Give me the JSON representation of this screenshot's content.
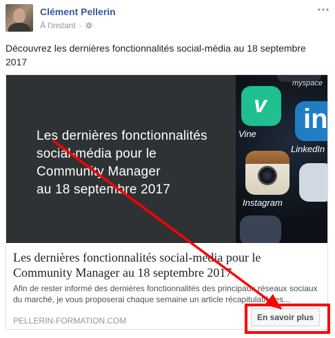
{
  "post": {
    "author": "Clément Pellerin",
    "timestamp": "À l'instant",
    "separator": "·",
    "privacy_icon": "gear-icon",
    "menu_icon": "more-icon",
    "text": "Découvrez les dernières fonctionnalités social-média au 18 septembre 2017"
  },
  "link": {
    "image_text_lines": [
      "Les dernières fonctionnalités",
      "social-média pour le",
      "Community Manager",
      "au 18 septembre 2017"
    ],
    "app_labels": {
      "vine": "Vine",
      "linkedin": "LinkedIn",
      "instagram": "Instagram",
      "myspace": "myspace"
    },
    "title": "Les dernières fonctionnalités social-média pour le Community Manager au 18 septembre 2017",
    "description": "Afin de rester informé des dernières fonctionnalités des principaux réseaux sociaux du marché, je vous proposerai chaque semaine un article récapitulatif.Les...",
    "domain": "PELLERIN-FORMATION.COM",
    "cta_label": "En savoir plus"
  },
  "colors": {
    "name_blue": "#365899",
    "annotation_red": "#ff0000",
    "image_bg": "#2f3234",
    "vine_green": "#1fbf8f",
    "linkedin_blue": "#1f7dc4"
  }
}
